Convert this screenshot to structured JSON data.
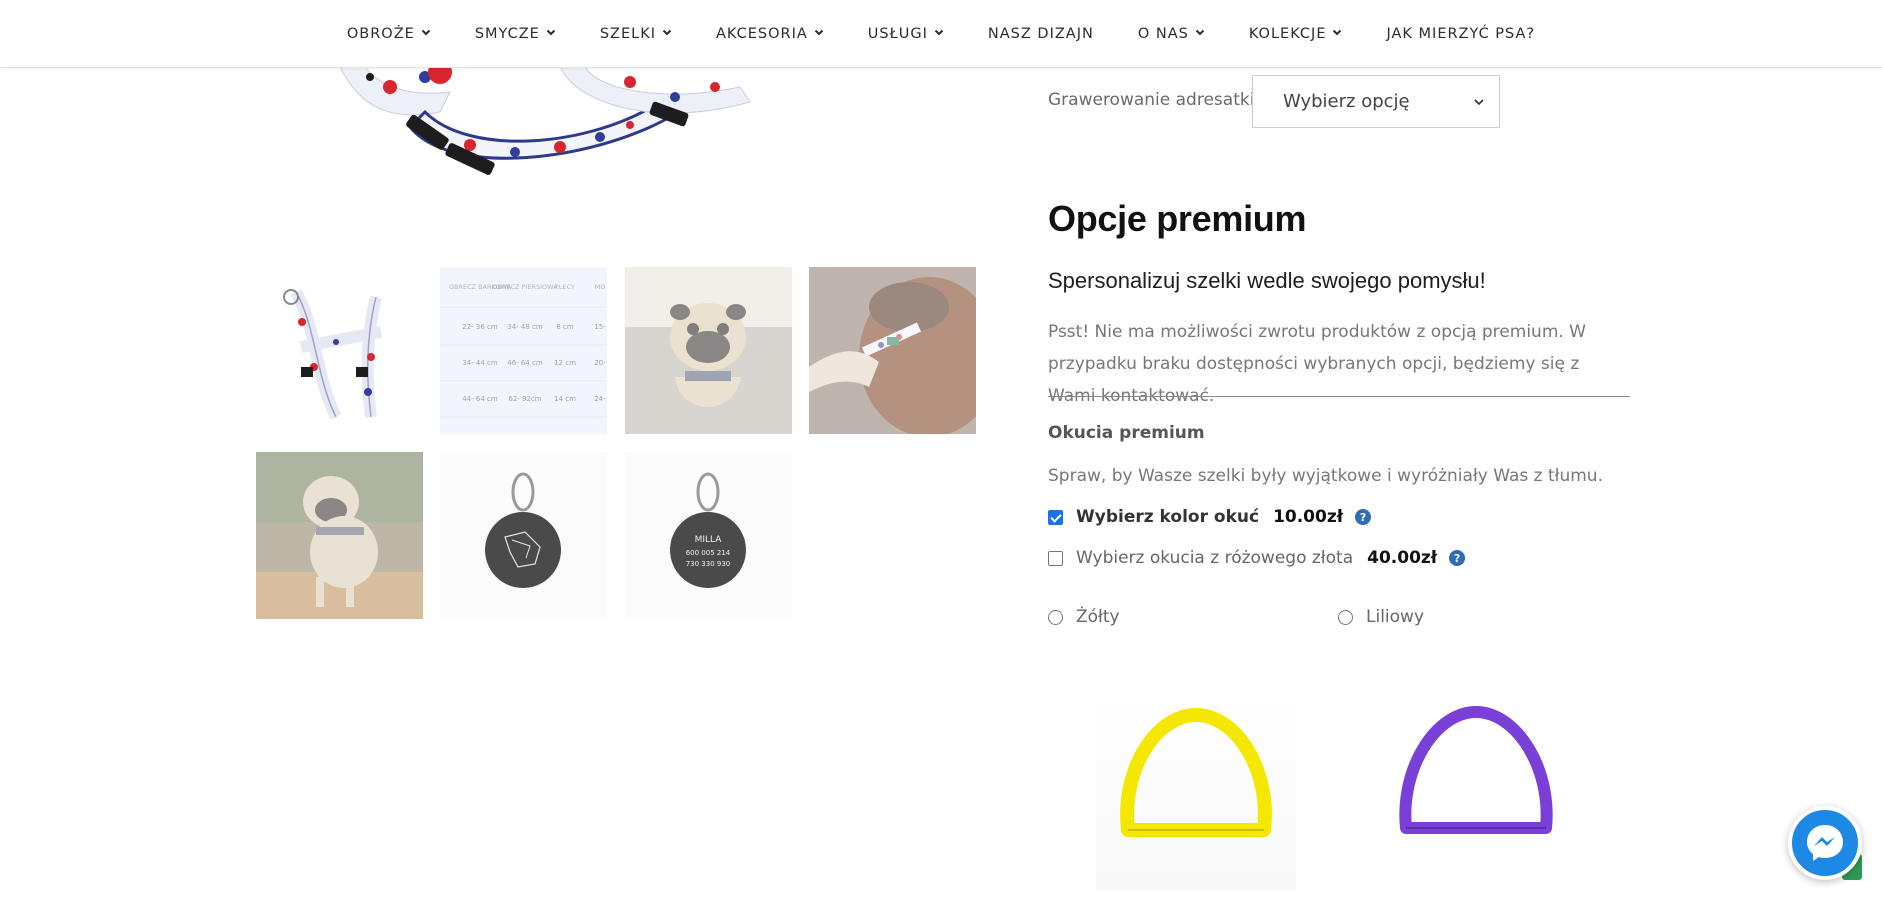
{
  "nav": {
    "items": [
      {
        "label": "OBROŻE",
        "has_dropdown": true
      },
      {
        "label": "SMYCZE",
        "has_dropdown": true
      },
      {
        "label": "SZELKI",
        "has_dropdown": true
      },
      {
        "label": "AKCESORIA",
        "has_dropdown": true
      },
      {
        "label": "USŁUGI",
        "has_dropdown": true
      },
      {
        "label": "NASZ DIZAJN",
        "has_dropdown": false
      },
      {
        "label": "O NAS",
        "has_dropdown": true
      },
      {
        "label": "KOLEKCJE",
        "has_dropdown": true
      },
      {
        "label": "JAK MIERZYĆ PSA?",
        "has_dropdown": false
      }
    ]
  },
  "size_table": {
    "headers": [
      "OBRECZ BARKOWA",
      "OBRECZ PIERSIOWA",
      "PLECY",
      "MO"
    ],
    "rows": [
      [
        "22- 36 cm",
        "34- 48 cm",
        "8 cm",
        "15-"
      ],
      [
        "34- 44 cm",
        "46- 64 cm",
        "12 cm",
        "20-"
      ],
      [
        "44- 64 cm",
        "62- 92cm",
        "14 cm",
        "24-"
      ]
    ]
  },
  "tag": {
    "name": "MILLA",
    "phone1": "600 005 214",
    "phone2": "730 330 930"
  },
  "product": {
    "engraving_label": "Grawerowanie adresatki",
    "engraving_select": "Wybierz opcję"
  },
  "premium": {
    "title": "Opcje premium",
    "subtitle": "Spersonalizuj szelki wedle swojego pomysłu!",
    "description": "Psst! Nie ma możliwości zwrotu produktów z opcją premium. W przypadku braku dostępności wybranych opcji, będziemy się z Wami kontaktować.",
    "section_title": "Okucia premium",
    "section_desc": "Spraw, by Wasze szelki były wyjątkowe i wyróżniały Was z tłumu.",
    "options": [
      {
        "label": "Wybierz kolor okuć",
        "price": "10.00zł",
        "checked": true
      },
      {
        "label": "Wybierz okucia z różowego złota",
        "price": "40.00zł",
        "checked": false
      }
    ],
    "colors": [
      {
        "label": "Żółty",
        "swatch": "#f7e800"
      },
      {
        "label": "Liliowy",
        "swatch": "#7a3fd6"
      }
    ]
  },
  "icons": {
    "chevron": "chevron-down-icon",
    "help": "question-circle-icon",
    "messenger": "messenger-icon"
  }
}
